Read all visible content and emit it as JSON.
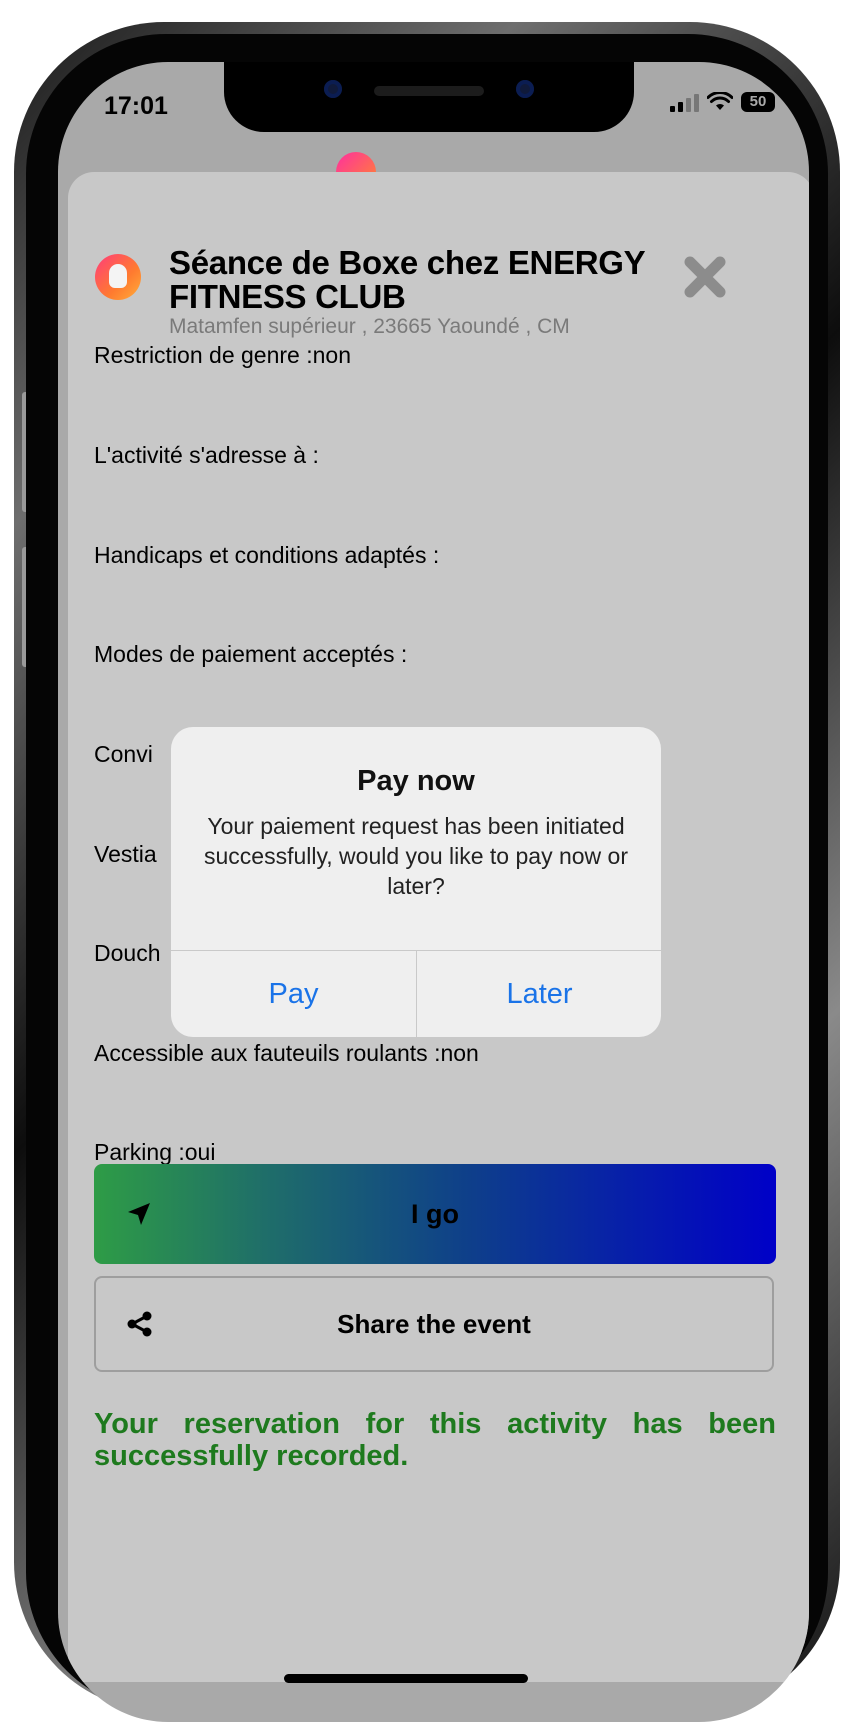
{
  "status_bar": {
    "time": "17:01",
    "battery": "50",
    "icons": [
      "signal-icon",
      "wifi-icon",
      "battery-icon"
    ]
  },
  "event": {
    "title": "Séance  de Boxe chez ENERGY FITNESS CLUB",
    "address": "Matamfen supérieur , 23665 Yaoundé , CM",
    "close_icon": "close-icon",
    "logo_icon": "boxing-glove-icon"
  },
  "info_lines": [
    {
      "name": "gender-restriction",
      "text": "Restriction de genre :non"
    },
    {
      "name": "audience",
      "text": "L'activité s'adresse à :"
    },
    {
      "name": "disability-conditions",
      "text": "Handicaps et conditions adaptés :"
    },
    {
      "name": "payment-modes",
      "text": "Modes de paiement acceptés :"
    },
    {
      "name": "convivial",
      "text": "Convi"
    },
    {
      "name": "changing-rooms",
      "text": "Vestia"
    },
    {
      "name": "showers",
      "text": "Douch"
    },
    {
      "name": "wheelchair-access",
      "text": "Accessible aux fauteuils roulants :non"
    },
    {
      "name": "parking",
      "text": "Parking :oui"
    }
  ],
  "actions": {
    "go_label": "I go",
    "go_icon": "navigation-arrow-icon",
    "share_label": "Share the event",
    "share_icon": "share-icon"
  },
  "success_message": "Your reservation for this activity has been successfully recorded.",
  "dialog": {
    "title": "Pay now",
    "message": "Your paiement request has been initiated successfully, would you like to pay now or later?",
    "pay_label": "Pay",
    "later_label": "Later"
  },
  "colors": {
    "link_blue": "#1a73e8",
    "success_green": "#1e7a1e",
    "gradient_start": "#2e9c46",
    "gradient_end": "#0000c8"
  }
}
